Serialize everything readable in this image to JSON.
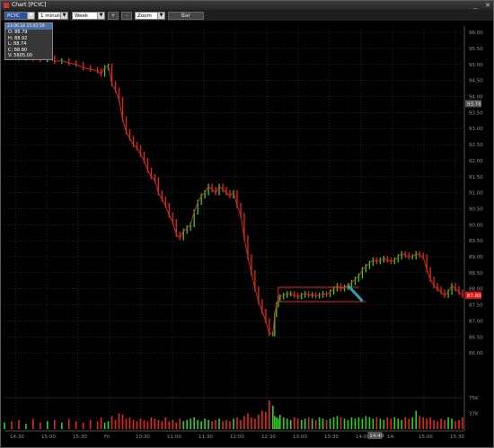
{
  "window": {
    "title": "Chart [PCYC]"
  },
  "toolbar": {
    "symbol": "PCYC",
    "interval": "1 minute",
    "range": "Week",
    "zoom_in": "+",
    "zoom_out": "-",
    "zoom": "Zoom",
    "chart_style": "Bar"
  },
  "ohlc_box": {
    "header": "23.06.14 15:01:59",
    "open": "O: 88.79",
    "high": "H: 88.92",
    "low": "L: 88.74",
    "close": "C: 88.80",
    "volume": "V: 5605.00"
  },
  "price_axis": {
    "labels": [
      "96.00",
      "95.50",
      "95.00",
      "94.50",
      "94.00",
      "93.50",
      "93.00",
      "92.50",
      "92.00",
      "91.50",
      "91.00",
      "90.50",
      "90.00",
      "89.50",
      "89.00",
      "88.50",
      "88.00",
      "87.50",
      "87.00",
      "86.50",
      "86.00"
    ],
    "current_price": "87.80",
    "highlight_label": "93.78"
  },
  "volume_axis": {
    "labels": [
      "75K",
      "37K"
    ]
  },
  "time_axis": {
    "labels": [
      "14:30",
      "15:00",
      "15:30",
      "Fri",
      "10:30",
      "11:00",
      "11:30",
      "12:00",
      "12:30",
      "13:00",
      "13:30",
      "14:00",
      "14:",
      "15:00",
      "15:30"
    ],
    "cursor_label": "14:40"
  },
  "colors": {
    "up": "#2fd21f",
    "down": "#e3281c",
    "box": "#e3281c",
    "arrow": "#2ba3b4",
    "grid": "#4a4a4a"
  },
  "chart_data": {
    "type": "line",
    "title": "",
    "ylabel": "",
    "ylim": [
      85.5,
      96.2
    ],
    "x": [
      0,
      8,
      16,
      24,
      32,
      40,
      48,
      56,
      64,
      72,
      80,
      88,
      96,
      104,
      108,
      112,
      116,
      120,
      124,
      128,
      132,
      136,
      140,
      144,
      148,
      152,
      156,
      160,
      164,
      168,
      172,
      176,
      180,
      184,
      188,
      192,
      196,
      200,
      204,
      208,
      212,
      216,
      220,
      224,
      228,
      232,
      236,
      240,
      244,
      248,
      252,
      256,
      260,
      264,
      268,
      272,
      276,
      280,
      284,
      288,
      292,
      296,
      300,
      302,
      304,
      306,
      308,
      312,
      316,
      320,
      324,
      328,
      332,
      336,
      340,
      344,
      348,
      352,
      356,
      360,
      364,
      368,
      372,
      376,
      380,
      384,
      388,
      392,
      396,
      400,
      404,
      408,
      412,
      416,
      420,
      424,
      428,
      432,
      436,
      440,
      444,
      448,
      452,
      456,
      460,
      464,
      468,
      472,
      476,
      480,
      484,
      488,
      492,
      496,
      500,
      504,
      508,
      512
    ],
    "series": [
      {
        "values": [
          95.35,
          95.3,
          95.2,
          95.25,
          95.18,
          95.15,
          95.2,
          95.1,
          95.12,
          95.05,
          95.0,
          94.9,
          94.85,
          94.8,
          94.7,
          94.9,
          94.95,
          94.4,
          94.2,
          93.9,
          93.3,
          92.9,
          92.7,
          92.5,
          92.4,
          92.2,
          92.0,
          91.7,
          91.5,
          91.4,
          91.0,
          90.8,
          90.6,
          90.3,
          90.1,
          89.7,
          89.6,
          89.8,
          89.9,
          90.0,
          90.4,
          90.7,
          90.9,
          91.0,
          91.2,
          91.1,
          91.0,
          91.2,
          91.1,
          91.0,
          90.9,
          91.0,
          90.6,
          90.3,
          89.6,
          89.0,
          88.5,
          88.0,
          87.6,
          87.3,
          87.0,
          86.6,
          86.6,
          87.2,
          87.5,
          87.7,
          87.75,
          87.8,
          87.85,
          87.85,
          87.8,
          87.75,
          87.8,
          87.85,
          87.8,
          87.82,
          87.78,
          87.8,
          87.85,
          87.82,
          87.9,
          88.0,
          88.1,
          88.0,
          88.05,
          88.1,
          88.2,
          88.3,
          88.4,
          88.6,
          88.7,
          88.8,
          88.9,
          88.85,
          88.9,
          88.95,
          88.9,
          88.85,
          88.9,
          89.0,
          89.1,
          89.05,
          89.0,
          89.0,
          89.1,
          89.05,
          89.0,
          88.6,
          88.3,
          88.1,
          88.0,
          87.9,
          87.8,
          87.9,
          88.1,
          88.0,
          87.9,
          87.8
        ]
      }
    ],
    "box_high": 88.05,
    "box_low": 87.6,
    "volume": [
      5,
      6,
      7,
      4,
      8,
      5,
      6,
      7,
      5,
      8,
      6,
      5,
      7,
      6,
      9,
      5,
      6,
      10,
      7,
      12,
      11,
      8,
      9,
      7,
      6,
      8,
      7,
      6,
      9,
      8,
      7,
      6,
      9,
      6,
      7,
      5,
      8,
      6,
      7,
      8,
      9,
      7,
      6,
      8,
      7,
      6,
      7,
      8,
      6,
      7,
      6,
      8,
      9,
      7,
      10,
      12,
      9,
      8,
      11,
      14,
      13,
      22,
      18,
      10,
      9,
      8,
      11,
      9,
      8,
      7,
      9,
      8,
      7,
      8,
      9,
      8,
      7,
      9,
      8,
      7,
      8,
      9,
      10,
      9,
      8,
      7,
      9,
      8,
      9,
      8,
      10,
      9,
      8,
      9,
      8,
      7,
      9,
      8,
      9,
      8,
      7,
      9,
      8,
      9,
      14,
      10,
      9,
      8,
      9,
      7,
      6,
      8,
      7,
      9,
      8,
      6,
      7,
      9,
      8,
      7
    ]
  }
}
